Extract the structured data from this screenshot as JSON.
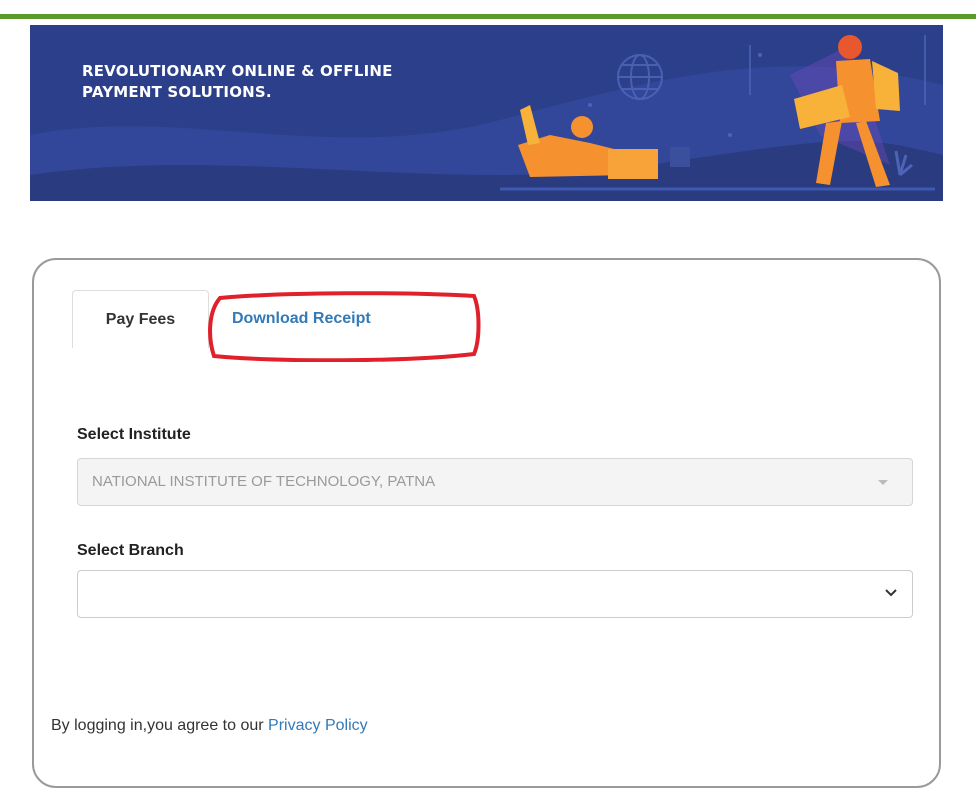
{
  "banner": {
    "title_line1": "REVOLUTIONARY ONLINE & OFFLINE",
    "title_line2": "PAYMENT SOLUTIONS.",
    "illustration_icon": "people-with-laptops-illustration"
  },
  "tabs": [
    {
      "label": "Pay Fees",
      "active": true
    },
    {
      "label": "Download Receipt",
      "active": false,
      "highlighted": true
    }
  ],
  "form": {
    "institute": {
      "label": "Select Institute",
      "value": "NATIONAL INSTITUTE OF TECHNOLOGY, PATNA",
      "disabled": true
    },
    "branch": {
      "label": "Select Branch",
      "value": ""
    }
  },
  "footer": {
    "text": "By logging in,you agree to our",
    "link": "Privacy Policy"
  },
  "colors": {
    "top_bar": "#5a9a2a",
    "banner_bg": "#2c3f8a",
    "link": "#337ab7",
    "highlight": "#e0202a",
    "accent_orange": "#f5922f"
  }
}
